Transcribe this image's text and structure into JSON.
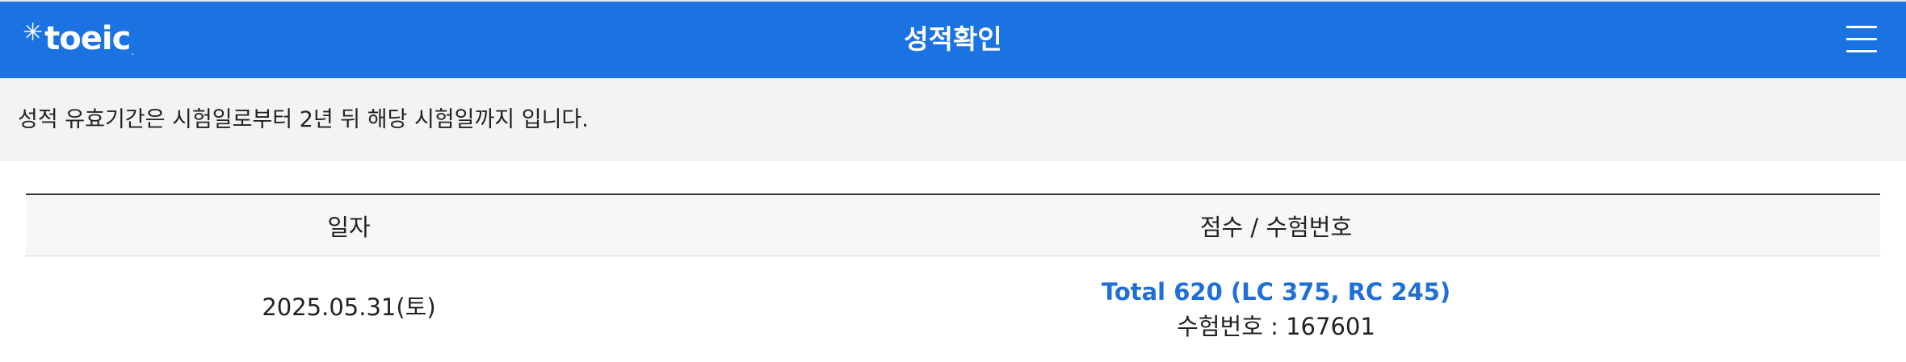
{
  "header": {
    "logo_text": "toeic",
    "logo_star": "✳",
    "logo_dot": ".",
    "title": "성적확인",
    "menu_icon": "hamburger-menu-icon",
    "background_color": "#1a73e0"
  },
  "notice": {
    "text": "성적 유효기간은 시험일로부터 2년 뒤 해당 시험일까지 입니다."
  },
  "table": {
    "columns": [
      "일자",
      "점수 / 수험번호"
    ],
    "rows": [
      {
        "date": "2025.05.31(토)",
        "score": "Total 620 (LC 375, RC 245)",
        "exam_number": "수험번호 : 167601"
      }
    ]
  },
  "colors": {
    "score_link": "#1f6fd6",
    "notice_background": "#f3f3f3"
  }
}
